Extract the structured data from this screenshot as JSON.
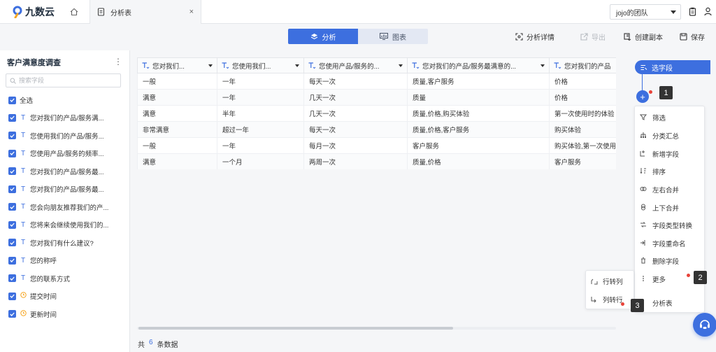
{
  "app": {
    "logo_text": "九数云"
  },
  "tabs": [
    {
      "label": "分析表",
      "close": "×"
    }
  ],
  "team": {
    "selected": "jojo的团队"
  },
  "view_toggle": {
    "analysis": "分析",
    "chart": "图表"
  },
  "toolbar": {
    "detail": "分析详情",
    "export": "导出",
    "copy": "创建副本",
    "save": "保存"
  },
  "left_panel": {
    "title": "客户满意度调查",
    "search_placeholder": "搜索字段",
    "select_all": "全选",
    "fields": [
      {
        "type": "T",
        "label": "您对我们的产品/服务满..."
      },
      {
        "type": "T",
        "label": "您使用我们的产品/服务..."
      },
      {
        "type": "T",
        "label": "您使用产品/服务的频率..."
      },
      {
        "type": "T",
        "label": "您对我们的产品/服务最..."
      },
      {
        "type": "T",
        "label": "您对我们的产品/服务最..."
      },
      {
        "type": "T",
        "label": "您会向朋友推荐我们的产..."
      },
      {
        "type": "T",
        "label": "您将来会继续使用我们的..."
      },
      {
        "type": "T",
        "label": "您对我们有什么建议?"
      },
      {
        "type": "T",
        "label": "您的称呼"
      },
      {
        "type": "T",
        "label": "您的联系方式"
      },
      {
        "type": "clock",
        "label": "提交时间"
      },
      {
        "type": "clock",
        "label": "更新时间"
      }
    ]
  },
  "table": {
    "columns": [
      "您对我们...",
      "您使用我们...",
      "您使用产品/服务的...",
      "您对我们的产品/服务最满意的...",
      "您对我们的产品"
    ],
    "rows": [
      [
        "一般",
        "一年",
        "每天一次",
        "质量,客户服务",
        "价格"
      ],
      [
        "满意",
        "一年",
        "几天一次",
        "质量",
        "价格"
      ],
      [
        "满意",
        "半年",
        "几天一次",
        "质量,价格,购买体验",
        "第一次使用时的体验"
      ],
      [
        "非常满意",
        "超过一年",
        "每天一次",
        "质量,价格,客户服务",
        "购买体验"
      ],
      [
        "一般",
        "一年",
        "每月一次",
        "客户服务",
        "购买体验,第一次使用"
      ],
      [
        "满意",
        "一个月",
        "两周一次",
        "质量,价格",
        "客户服务"
      ]
    ]
  },
  "footer": {
    "prefix": "共",
    "count": "6",
    "suffix": "条数据"
  },
  "right_panel": {
    "select_field": "选字段",
    "add": "+",
    "menu": [
      "筛选",
      "分类汇总",
      "新增字段",
      "排序",
      "左右合并",
      "上下合并",
      "字段类型转换",
      "字段重命名",
      "删除字段",
      "更多",
      "分析表"
    ],
    "submenu": [
      "行转列",
      "列转行"
    ],
    "markers": [
      "1",
      "2",
      "3"
    ]
  },
  "colors": {
    "accent": "#3d6fdf",
    "marker": "#333333",
    "dot": "#e8433a"
  }
}
